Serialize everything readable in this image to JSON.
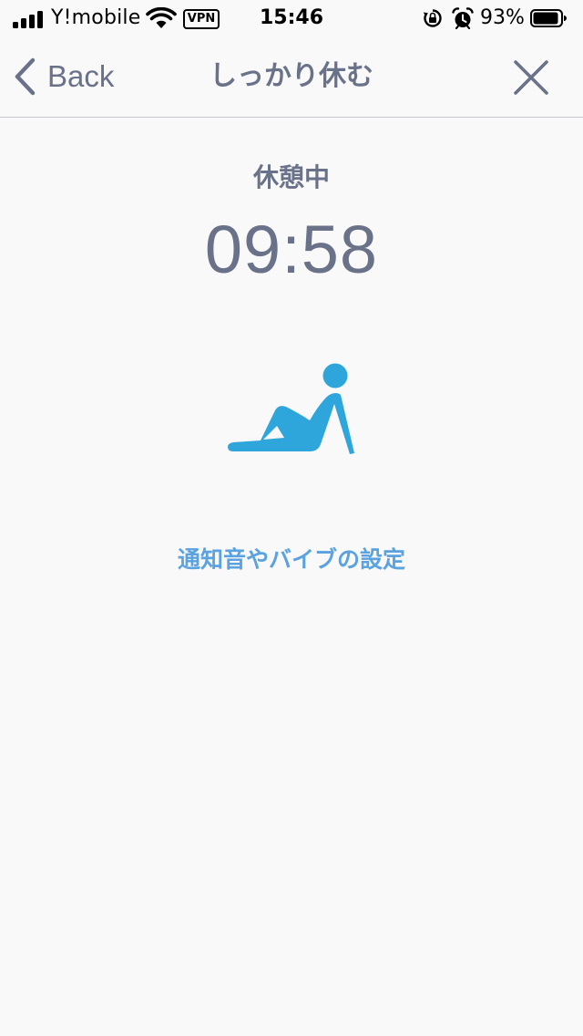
{
  "status_bar": {
    "carrier": "Y!mobile",
    "vpn_label": "VPN",
    "time": "15:46",
    "battery_percent": "93%",
    "battery_level": 0.93,
    "signal_bars": 4,
    "icons": [
      "signal-icon",
      "wifi-icon",
      "rotation-lock-icon",
      "alarm-icon",
      "battery-icon"
    ]
  },
  "nav": {
    "back_label": "Back",
    "title": "しっかり休む",
    "close_icon": "close-icon"
  },
  "main": {
    "status_label": "休憩中",
    "timer": "09:58",
    "figure_icon": "resting-person-icon",
    "settings_link": "通知音やバイブの設定"
  },
  "colors": {
    "accent_text": "#6a7289",
    "link": "#5aa2e0",
    "figure": "#2ea6dc",
    "background": "#f9f9f9",
    "divider": "#c8c8cc"
  }
}
